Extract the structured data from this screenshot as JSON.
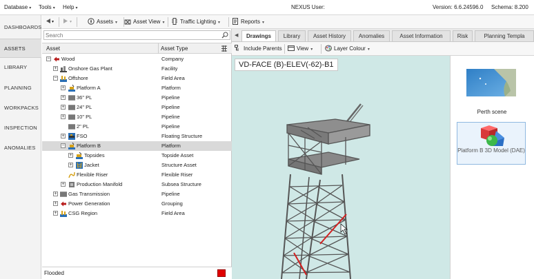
{
  "menubar": {
    "database": "Database",
    "tools": "Tools",
    "help": "Help",
    "user_label": "NEXUS User:",
    "version": "Version: 6.6.24596.0",
    "schema": "Schema: 8.200"
  },
  "leftnav": {
    "items": [
      {
        "label": "DASHBOARDS"
      },
      {
        "label": "ASSETS"
      },
      {
        "label": "LIBRARY"
      },
      {
        "label": "PLANNING"
      },
      {
        "label": "WORKPACKS"
      },
      {
        "label": "INSPECTION"
      },
      {
        "label": "ANOMALIES"
      }
    ],
    "active_index": 1
  },
  "toolbar": {
    "assets": "Assets",
    "asset_view": "Asset View",
    "traffic_lighting": "Traffic Lighting",
    "reports": "Reports"
  },
  "assetpanel": {
    "search_placeholder": "Search",
    "col_asset": "Asset",
    "col_type": "Asset Type",
    "rows": [
      {
        "name": "Wood",
        "type": "Company"
      },
      {
        "name": "Onshore Gas Plant",
        "type": "Facility"
      },
      {
        "name": "Offshore",
        "type": "Field Area"
      },
      {
        "name": "Platform A",
        "type": "Platform"
      },
      {
        "name": "36\" PL",
        "type": "Pipeline"
      },
      {
        "name": "24\" PL",
        "type": "Pipeline"
      },
      {
        "name": "10\" PL",
        "type": "Pipeline"
      },
      {
        "name": "2\" PL",
        "type": "Pipeline"
      },
      {
        "name": "FSO",
        "type": "Floating Structure"
      },
      {
        "name": "Platform B",
        "type": "Platform"
      },
      {
        "name": "Topsides",
        "type": "Topside Asset"
      },
      {
        "name": "Jacket",
        "type": "Structure Asset"
      },
      {
        "name": "Flexible Riser",
        "type": "Flexible Riser"
      },
      {
        "name": "Production Manifold",
        "type": "Subsea Structure"
      },
      {
        "name": "Gas Transmission",
        "type": "Pipeline"
      },
      {
        "name": "Power Generation",
        "type": "Grouping"
      },
      {
        "name": "CSG Region",
        "type": "Field Area"
      }
    ],
    "selected_row": "Platform B",
    "status_label": "Flooded",
    "status_color": "#e00000"
  },
  "tabs": {
    "items": [
      {
        "label": "Drawings"
      },
      {
        "label": "Library"
      },
      {
        "label": "Asset History"
      },
      {
        "label": "Anomalies"
      },
      {
        "label": "Asset Information"
      },
      {
        "label": "Risk"
      },
      {
        "label": "Planning Templa"
      }
    ],
    "active": "Drawings"
  },
  "subtoolbar": {
    "include_parents": "Include Parents",
    "view": "View",
    "layer_colour": "Layer Colour"
  },
  "viewer": {
    "drawing_title": "VD-FACE (B)-ELEV(-62)-B1",
    "background": "#cfe8e6",
    "highlight_color": "#d21f1f"
  },
  "scenepanel": {
    "scene_label": "Perth scene",
    "model_label": "Platform B 3D Model (DAE)"
  }
}
